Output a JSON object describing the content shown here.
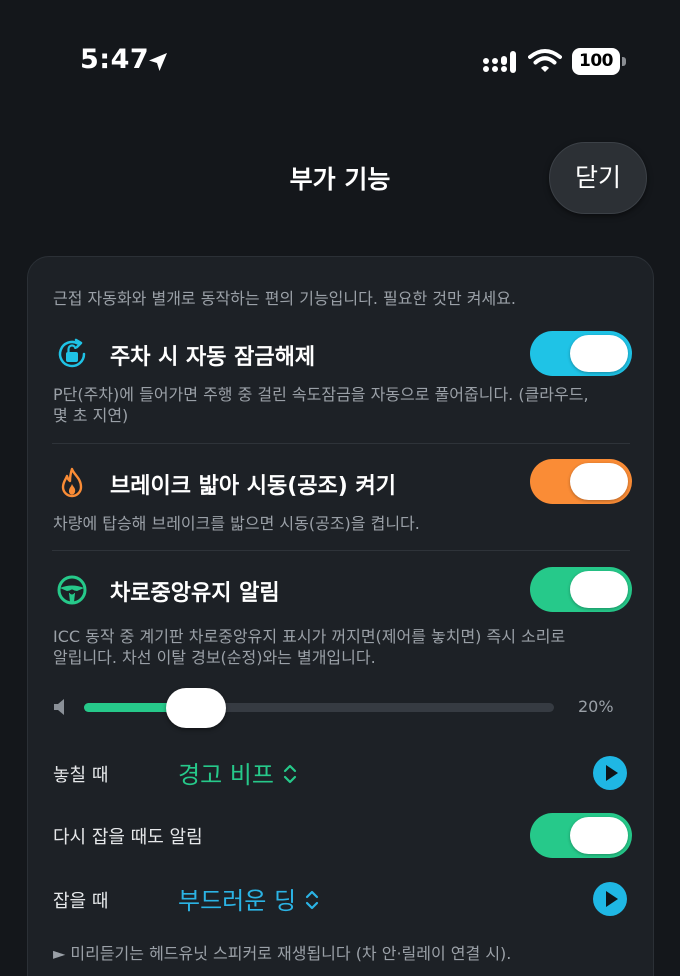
{
  "status_bar": {
    "time": "5:47",
    "battery": "100"
  },
  "header": {
    "title": "부가 기능",
    "close_label": "닫기"
  },
  "card": {
    "intro": "근접 자동화와 별개로 동작하는 편의 기능입니다. 필요한 것만 켜세요.",
    "features": [
      {
        "title": "주차 시 자동 잠금해제",
        "desc_line1": "P단(주차)에 들어가면 주행 중 걸린 속도잠금을 자동으로 풀어줍니다. (클라우드,",
        "desc_line2": "몇 초 지연)",
        "enabled": true,
        "accent": "#1fc3e6"
      },
      {
        "title": "브레이크 밟아 시동(공조) 켜기",
        "desc_line1": "차량에 탑승해 브레이크를 밟으면 시동(공조)을 켭니다.",
        "enabled": true,
        "accent": "#fa8c36"
      },
      {
        "title": "차로중앙유지 알림",
        "desc_line1": "ICC 동작 중 계기판 차로중앙유지 표시가 꺼지면(제어를 놓치면) 즉시 소리로",
        "desc_line2": "알립니다. 차선 이탈 경보(순정)와는 별개입니다.",
        "enabled": true,
        "accent": "#26c98a"
      }
    ],
    "volume": {
      "value": 20,
      "label": "20%"
    },
    "lost_sound": {
      "label": "놓칠 때",
      "value": "경고 비프",
      "icon": "chevron-updown-icon"
    },
    "regain_alert": {
      "label": "다시 잡을 때도 알림",
      "enabled": true
    },
    "regain_sound": {
      "label": "잡을 때",
      "value": "부드러운 딩",
      "icon": "chevron-updown-icon"
    },
    "footnote": "► 미리듣기는 헤드유닛 스피커로 재생됩니다 (차 안·릴레이 연결 시)."
  },
  "icons": [
    "location-arrow-icon",
    "signal-icon",
    "wifi-icon",
    "battery-icon",
    "unlock-rotate-icon",
    "flame-icon",
    "steering-wheel-icon",
    "speaker-icon",
    "play-icon"
  ]
}
